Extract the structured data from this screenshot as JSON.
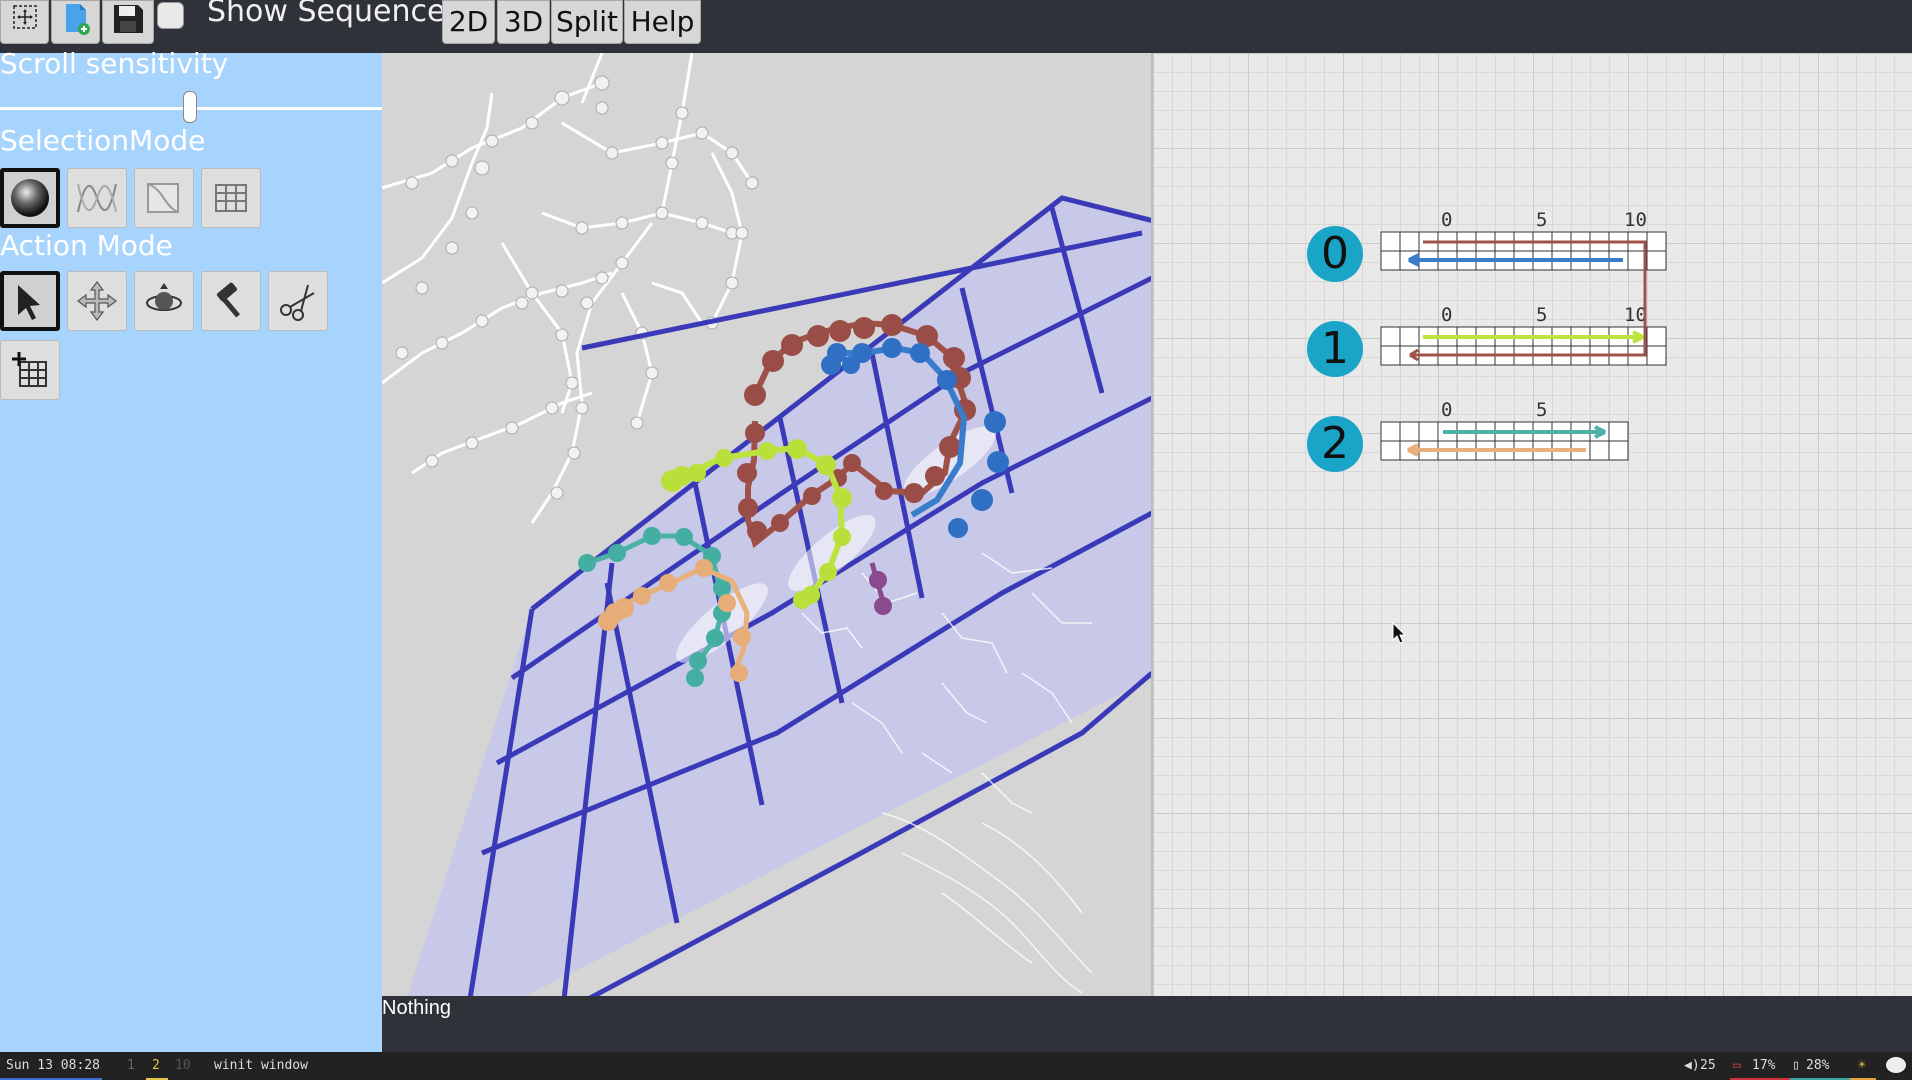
{
  "toolbar": {
    "show_sequences_label": "Show Sequences",
    "view_2d": "2D",
    "view_3d": "3D",
    "split": "Split",
    "help": "Help",
    "icons": [
      "fit-view-icon",
      "new-file-icon",
      "save-icon"
    ]
  },
  "left_panel": {
    "scroll_sensitivity_label": "Scroll sensitivity",
    "scroll_sensitivity_value": 0.5,
    "selection_mode_label": "SelectionMode",
    "selection_modes": [
      "nucleotide-icon",
      "strand-icon",
      "helix-icon",
      "grid-icon"
    ],
    "selected_selection_mode": "nucleotide",
    "action_mode_label": "Action Mode",
    "action_modes": [
      "select-arrow-icon",
      "translate-icon",
      "rotate-icon",
      "build-hammer-icon",
      "cut-scissors-icon"
    ],
    "selected_action_mode": "select",
    "extra_tool": "add-grid-icon"
  },
  "helices": [
    {
      "id": "0",
      "ticks": [
        "0",
        "5",
        "10"
      ]
    },
    {
      "id": "1",
      "ticks": [
        "0",
        "5",
        "10"
      ]
    },
    {
      "id": "2",
      "ticks": [
        "0",
        "5"
      ]
    }
  ],
  "status": {
    "message": "Nothing"
  },
  "system_bar": {
    "datetime": "Sun 13 08:28",
    "workspaces": [
      "1",
      "2",
      "10"
    ],
    "active_workspace": "2",
    "window_title": "winit window",
    "volume": "25",
    "cpu": "17%",
    "memory": "28%"
  },
  "colors": {
    "left_panel_bg": "#a6d4fd",
    "helix_badge": "#1aa4c7",
    "grid_blue": "#3a3ab8",
    "strand_brown": "#a0524a",
    "strand_blue": "#3a7ccc",
    "strand_lime": "#bde43e",
    "strand_teal": "#4ab3a6",
    "strand_peach": "#e8b07a",
    "strand_purple": "#8a4a8e"
  }
}
